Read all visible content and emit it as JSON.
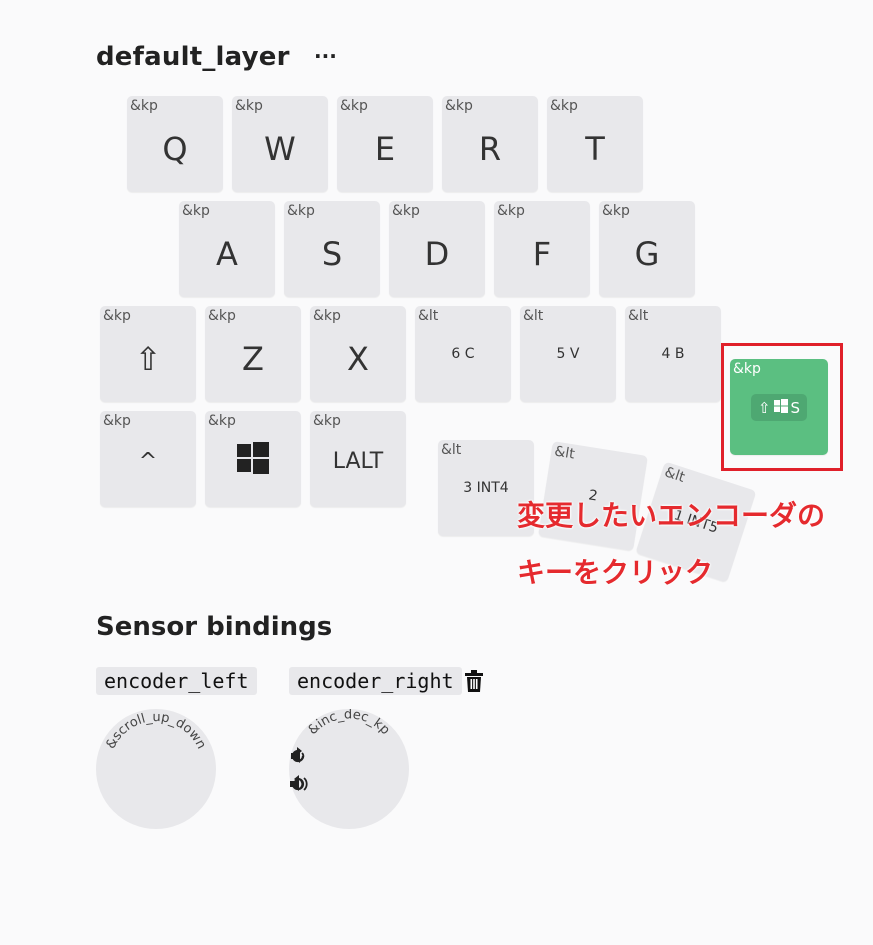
{
  "layer": {
    "title": "default_layer",
    "menu": "···"
  },
  "keys": {
    "q": {
      "behavior": "&kp",
      "legend": "Q"
    },
    "w": {
      "behavior": "&kp",
      "legend": "W"
    },
    "e": {
      "behavior": "&kp",
      "legend": "E"
    },
    "r": {
      "behavior": "&kp",
      "legend": "R"
    },
    "t": {
      "behavior": "&kp",
      "legend": "T"
    },
    "a": {
      "behavior": "&kp",
      "legend": "A"
    },
    "s": {
      "behavior": "&kp",
      "legend": "S"
    },
    "d": {
      "behavior": "&kp",
      "legend": "D"
    },
    "f": {
      "behavior": "&kp",
      "legend": "F"
    },
    "g": {
      "behavior": "&kp",
      "legend": "G"
    },
    "shift": {
      "behavior": "&kp",
      "legend": "⇧"
    },
    "z": {
      "behavior": "&kp",
      "legend": "Z"
    },
    "x": {
      "behavior": "&kp",
      "legend": "X"
    },
    "lt6c": {
      "behavior": "&lt",
      "legend": "6 C"
    },
    "lt5v": {
      "behavior": "&lt",
      "legend": "5 V"
    },
    "lt4b": {
      "behavior": "&lt",
      "legend": "4 B"
    },
    "caret": {
      "behavior": "&kp",
      "legend": "^"
    },
    "win": {
      "behavior": "&kp",
      "icon": "windows-icon"
    },
    "lalt": {
      "behavior": "&kp",
      "legend": "LALT"
    },
    "lt3int4": {
      "behavior": "&lt",
      "legend": "3 INT4"
    },
    "lt2": {
      "behavior": "&lt",
      "legend": "2"
    },
    "lt1int5": {
      "behavior": "&lt",
      "legend": "1 INT5"
    },
    "selected": {
      "behavior": "&kp",
      "shift": "⇧",
      "icon": "windows-icon",
      "legend": "S"
    }
  },
  "annotation": {
    "line1": "変更したいエンコーダの",
    "line2": "キーをクリック",
    "color": "#e52a2e"
  },
  "sensor": {
    "title": "Sensor bindings",
    "left": {
      "label": "encoder_left",
      "behavior": "&scroll_up_down"
    },
    "right": {
      "label": "encoder_right",
      "behavior": "&inc_dec_kp"
    }
  },
  "colors": {
    "selected": "#5bbf81",
    "key": "#e8e8eb",
    "highlight": "#e0202a"
  }
}
